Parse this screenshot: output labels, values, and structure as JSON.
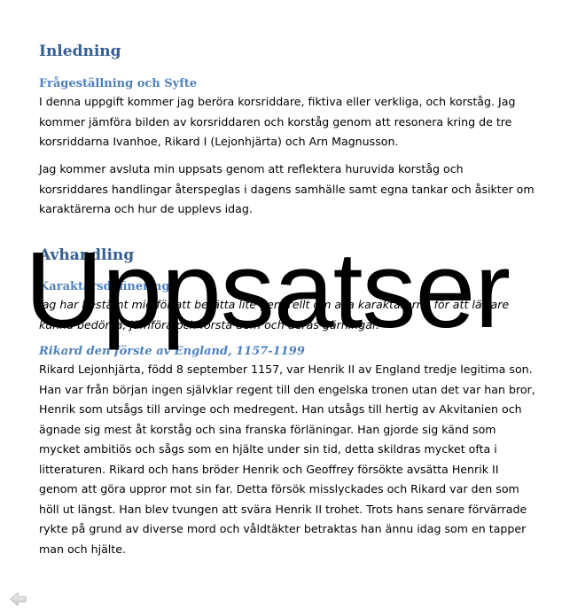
{
  "sections": [
    {
      "heading": "Inledning",
      "sub": "Frågeställning och Syfte",
      "p1": "I denna uppgift kommer jag beröra korsriddare, fiktiva eller verkliga, och korståg. Jag kommer jämföra bilden av korsriddaren och korståg genom att resonera kring de tre korsriddarna Ivanhoe, Rikard I (Lejonhjärta) och Arn Magnusson.",
      "p2": "Jag kommer avsluta min uppsats genom att reflektera huruvida korståg och korsriddares handlingar återspeglas i dagens samhälle samt egna tankar och åsikter om karaktärerna och hur de upplevs idag."
    },
    {
      "heading": "Avhandling",
      "sub": "Karaktärsdefinering",
      "p1": "Jag har bestämt mig för att berätta lite generellt om alla karaktärerna för att lättare kunna bedöma, jämföra och förstå dem och deras gärningar.",
      "sub2": "Rikard den förste av England, 1157-1199",
      "p2": "Rikard Lejonhjärta, född 8 september 1157, var Henrik II av England tredje legitima son. Han var från början ingen självklar regent till den engelska tronen utan det var han bror, Henrik som utsågs till arvinge och medregent. Han utsågs till hertig av Akvitanien och ägnade sig mest åt korståg och sina franska förläningar. Han gjorde sig känd som mycket ambitiös och sågs som en hjälte under sin tid, detta skildras mycket ofta i litteraturen. Rikard och hans bröder Henrik och Geoffrey försökte avsätta Henrik II genom att göra uppror mot sin far. Detta försök misslyckades och Rikard var den som höll ut längst. Han blev tvungen att svära Henrik II trohet. Trots hans senare förvärrade rykte på grund av diverse mord och våldtäkter betraktas han ännu idag som en tapper man och hjälte."
    }
  ],
  "watermark": "Uppsatser",
  "nav": {
    "icon": "back-arrow-icon"
  }
}
